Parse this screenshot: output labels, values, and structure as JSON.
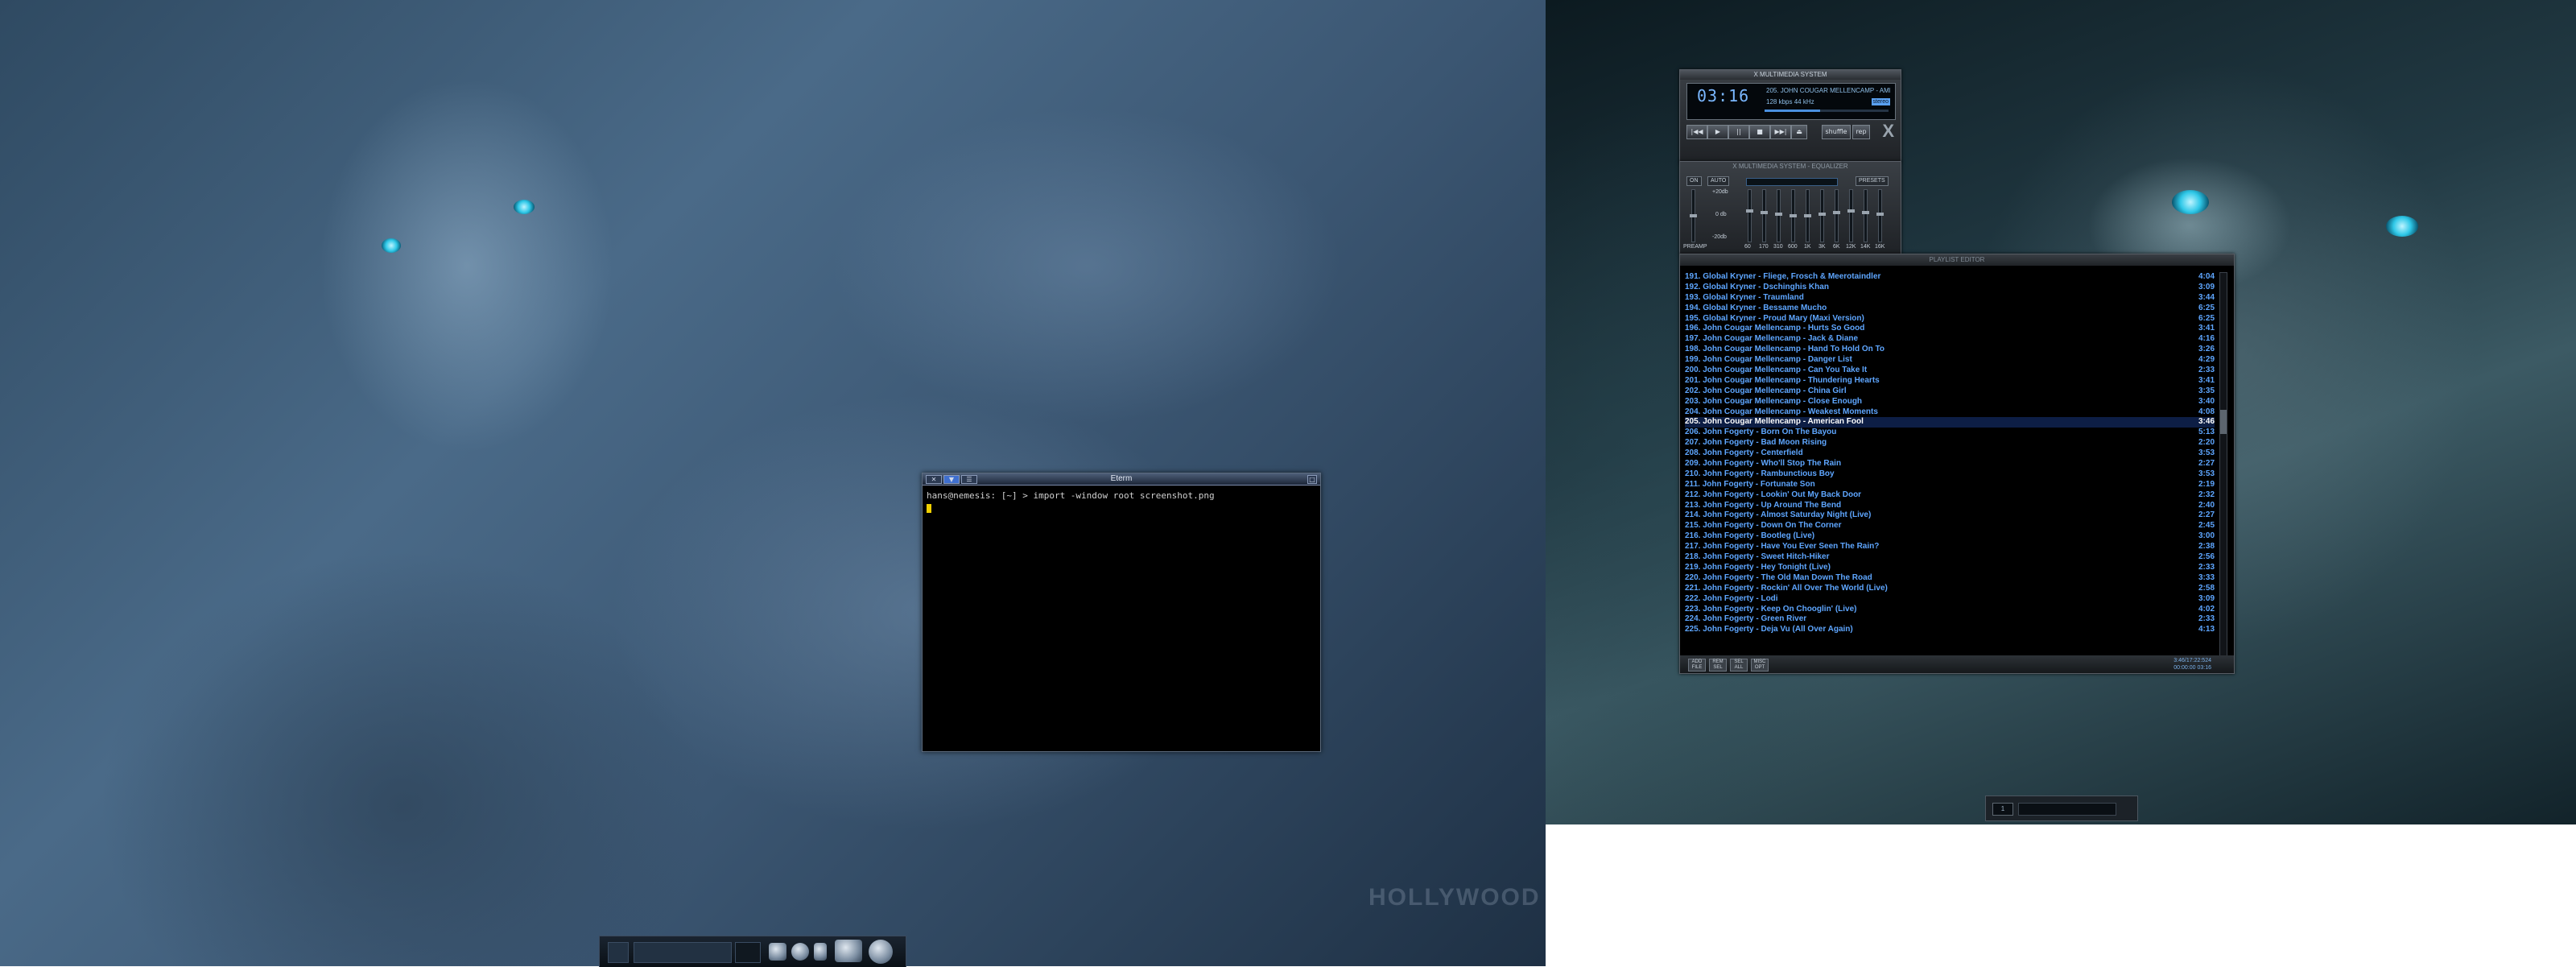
{
  "eterm": {
    "title": "Eterm",
    "prompt_line": "hans@nemesis: [~] > import -window root screenshot.png"
  },
  "watermark": "HOLLYWOOD",
  "xmms_main": {
    "window_title": "X MULTIMEDIA SYSTEM",
    "time": "03:16",
    "song_title": "205. JOHN COUGAR MELLENCAMP - AMERICAN FOOL",
    "bitrate": "128 kbps   44 kHz",
    "stereo": "stereo",
    "progress": 0.45,
    "controls": [
      "|◀◀",
      "▶",
      "||",
      "■",
      "▶▶|",
      "⏏"
    ],
    "extra": [
      "shuffle",
      "rep"
    ]
  },
  "equalizer": {
    "window_title": "X MULTIMEDIA SYSTEM - EQUALIZER",
    "buttons": {
      "on": "ON",
      "auto": "AUTO",
      "presets": "PRESETS"
    },
    "db_labels": [
      "+20db",
      "0 db",
      "-20db"
    ],
    "preamp": "PREAMP",
    "freqs": [
      "60",
      "170",
      "310",
      "600",
      "1K",
      "3K",
      "6K",
      "12K",
      "14K",
      "16K"
    ]
  },
  "playlist": {
    "window_title": "PLAYLIST EDITOR",
    "items": [
      {
        "text": "191. Global Kryner - Fliege, Frosch & Meerotaindler",
        "len": "4:04"
      },
      {
        "text": "192. Global Kryner - Dschinghis Khan",
        "len": "3:09"
      },
      {
        "text": "193. Global Kryner - Traumland",
        "len": "3:44"
      },
      {
        "text": "194. Global Kryner - Bessame Mucho",
        "len": "6:25"
      },
      {
        "text": "195. Global Kryner - Proud Mary (Maxi Version)",
        "len": "6:25"
      },
      {
        "text": "196. John Cougar Mellencamp - Hurts So Good",
        "len": "3:41"
      },
      {
        "text": "197. John Cougar Mellencamp - Jack & Diane",
        "len": "4:16"
      },
      {
        "text": "198. John Cougar Mellencamp - Hand To Hold On To",
        "len": "3:26"
      },
      {
        "text": "199. John Cougar Mellencamp - Danger List",
        "len": "4:29"
      },
      {
        "text": "200. John Cougar Mellencamp - Can You Take It",
        "len": "2:33"
      },
      {
        "text": "201. John Cougar Mellencamp - Thundering Hearts",
        "len": "3:41"
      },
      {
        "text": "202. John Cougar Mellencamp - China Girl",
        "len": "3:35"
      },
      {
        "text": "203. John Cougar Mellencamp - Close Enough",
        "len": "3:40"
      },
      {
        "text": "204. John Cougar Mellencamp - Weakest Moments",
        "len": "4:08"
      },
      {
        "text": "205. John Cougar Mellencamp - American Fool",
        "len": "3:46",
        "current": true
      },
      {
        "text": "206. John Fogerty - Born On The Bayou",
        "len": "5:13"
      },
      {
        "text": "207. John Fogerty - Bad Moon Rising",
        "len": "2:20"
      },
      {
        "text": "208. John Fogerty - Centerfield",
        "len": "3:53"
      },
      {
        "text": "209. John Fogerty - Who'll Stop The Rain",
        "len": "2:27"
      },
      {
        "text": "210. John Fogerty - Rambunctious Boy",
        "len": "3:53"
      },
      {
        "text": "211. John Fogerty - Fortunate Son",
        "len": "2:19"
      },
      {
        "text": "212. John Fogerty - Lookin' Out My Back Door",
        "len": "2:32"
      },
      {
        "text": "213. John Fogerty - Up Around The Bend",
        "len": "2:40"
      },
      {
        "text": "214. John Fogerty - Almost Saturday Night (Live)",
        "len": "2:27"
      },
      {
        "text": "215. John Fogerty - Down On The Corner",
        "len": "2:45"
      },
      {
        "text": "216. John Fogerty - Bootleg (Live)",
        "len": "3:00"
      },
      {
        "text": "217. John Fogerty - Have You Ever Seen The Rain?",
        "len": "2:38"
      },
      {
        "text": "218. John Fogerty - Sweet Hitch-Hiker",
        "len": "2:56"
      },
      {
        "text": "219. John Fogerty - Hey Tonight (Live)",
        "len": "2:33"
      },
      {
        "text": "220. John Fogerty - The Old Man Down The Road",
        "len": "3:33"
      },
      {
        "text": "221. John Fogerty - Rockin' All Over The World (Live)",
        "len": "2:58"
      },
      {
        "text": "222. John Fogerty - Lodi",
        "len": "3:09"
      },
      {
        "text": "223. John Fogerty - Keep On Chooglin' (Live)",
        "len": "4:02"
      },
      {
        "text": "224. John Fogerty - Green River",
        "len": "2:33"
      },
      {
        "text": "225. John Fogerty - Deja Vu (All Over Again)",
        "len": "4:13"
      }
    ],
    "buttons": [
      "ADD FILE",
      "REM SEL",
      "SEL ALL",
      "MISC OPT"
    ],
    "total_line1": "3:46/17:22:524",
    "total_line2": "00:00:00  03:16"
  },
  "mini_bar": {
    "value": "1"
  }
}
